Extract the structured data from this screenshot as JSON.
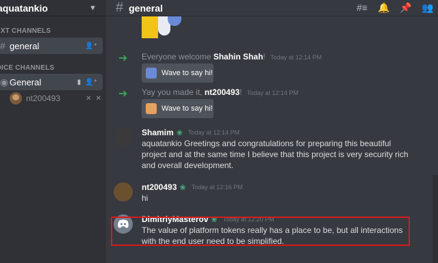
{
  "server": {
    "name": "aquatankio",
    "chevron_icon": "chevron-down-icon"
  },
  "sidebar": {
    "categories": [
      {
        "label": "EXT CHANNELS"
      },
      {
        "label": "OICE CHANNELS"
      }
    ],
    "text_channel": {
      "name": "general"
    },
    "voice_channel": {
      "name": "General"
    },
    "voice_user": {
      "name": "nt200493"
    }
  },
  "topbar": {
    "channel": "general",
    "tools": [
      "threads-icon",
      "bell-icon",
      "pin-icon",
      "members-icon"
    ]
  },
  "messages": {
    "system1": {
      "prefix": "Everyone welcome ",
      "name": "Shahin Shah",
      "suffix": "!",
      "timestamp": "Today at 12:14 PM",
      "wave": "Wave to say hi!"
    },
    "system2": {
      "prefix": "Yay you made it, ",
      "name": "nt200493",
      "suffix": "!",
      "timestamp": "Today at 12:14 PM",
      "wave": "Wave to say hi!"
    },
    "shamim": {
      "author": "Shamim",
      "timestamp": "Today at 12:14 PM",
      "text": "aquatankio Greetings and congratulations for preparing this beautiful project and at the same time I believe that this project is very security rich and overall development."
    },
    "nt": {
      "author": "nt200493",
      "timestamp": "Today at 12:16 PM",
      "text": "hi"
    },
    "dimitriy": {
      "author": "DimitriyMasterov",
      "timestamp": "Today at 12:20 PM",
      "text": "The value of platform tokens really has a place to be, but all interactions with the end user need to be simplified."
    }
  },
  "colors": {
    "accent_green": "#3ba55c",
    "highlight_border": "#d8191f",
    "sidebar_bg": "#2f3136",
    "chat_bg": "#36393f"
  }
}
